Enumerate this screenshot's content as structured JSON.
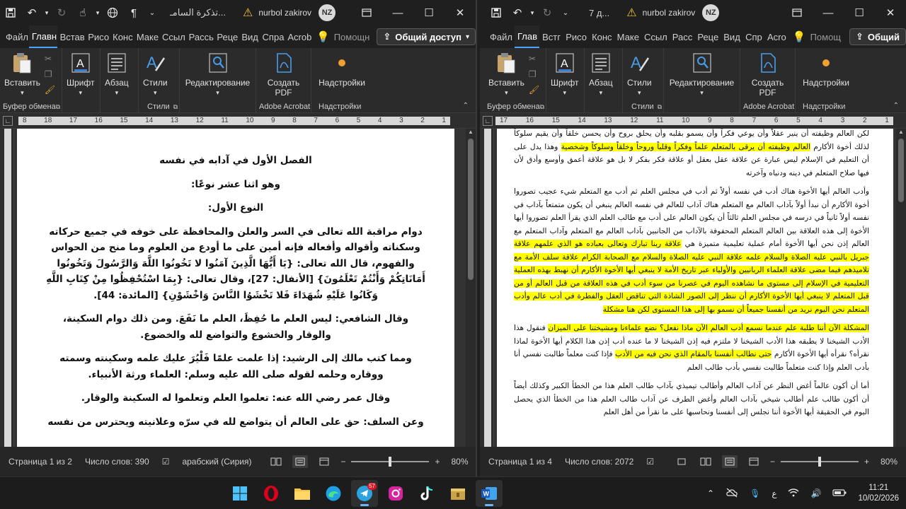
{
  "left_window": {
    "doc_title": "تذكرة السامـ...",
    "user_name": "nurbol zakirov",
    "user_initials": "NZ",
    "tabs": [
      "Файл",
      "Главн",
      "Встав",
      "Рисо",
      "Конс",
      "Маке",
      "Ссыл",
      "Рассь",
      "Реце",
      "Вид",
      "Спра",
      "Acrob"
    ],
    "active_tab_index": 1,
    "help_label": "Помощн",
    "share_label": "Общий доступ",
    "ribbon": {
      "paste_label": "Вставить",
      "font_label": "Шрифт",
      "paragraph_label": "Абзац",
      "styles_label": "Стили",
      "editing_label": "Редактирование",
      "create_pdf_label": "Создать PDF",
      "addins_label": "Надстройки",
      "clipboard_group": "Буфер обмена",
      "styles_group": "Стили",
      "acrobat_group": "Adobe Acrobat",
      "addins_group": "Надстройки"
    },
    "ruler_numbers": [
      "8",
      "18",
      "17",
      "16",
      "15",
      "14",
      "13",
      "12",
      "11",
      "10",
      "9",
      "8",
      "7",
      "6",
      "5",
      "4",
      "3",
      "2",
      "1"
    ],
    "status": {
      "page": "Страница 1 из 2",
      "words": "Число слов: 390",
      "language": "арабский (Сирия)",
      "zoom": "80%",
      "zoom_level": 0.5
    },
    "paragraphs": [
      "الفصل الأول في آدابه في نفسه",
      "وهو اثنا عشر نوعًا:",
      "النوع الأول:",
      "دوام مراقبة الله تعالى في السر والعلن والمحافظة على خوفه في جميع حركاته وسكناته وأقواله وأفعاله فإنه أمين على ما أودع من العلوم وما منح من الحواس والفهوم، قال الله تعالى: {يَا أَيُّهَا الَّذِينَ آمَنُوا لا تَخُونُوا اللَّهَ وَالرَّسُولَ وَتَخُونُوا أَمَانَاتِكُمْ وَأَنْتُمْ تَعْلَمُونَ} [الأنفال: 27]، وقال تعالى: {بِمَا اسْتُحْفِظُوا مِنْ كِتَابِ اللَّهِ وَكَانُوا عَلَيْهِ شُهَدَاءَ فَلا تَخْشَوُا النَّاسَ وَاخْشَوْنِ} [المائدة: 44].",
      "وقال الشافعي: ليس العلم ما حُفِظَ، العلم ما نَفَعَ. ومن ذلك دوام السكينة، والوقار والخشوع والتواضع لله والخضوع.",
      "ومما كتب مالك إلى الرشيد: إذا علمت علمًا فَلْيُرَ عليك علمه وسكينته وسمته ووقاره وحلمه لقوله صلى الله عليه وسلم: العلماء ورثة الأنبياء.",
      "وقال عمر رضي الله عنه: تعلموا العلم وتعلموا له السكينة والوقار.",
      "وعن السلف: حق على العالم أن يتواضع لله في سرّه وعلانيته ويحترس من نفسه"
    ]
  },
  "right_window": {
    "doc_title": "7 д...",
    "user_name": "nurbol zakirov",
    "user_initials": "NZ",
    "tabs": [
      "Файл",
      "Глав",
      "Встг",
      "Рисо",
      "Конс",
      "Маке",
      "Ссыл",
      "Расс",
      "Реце",
      "Вид",
      "Спр",
      "Acro"
    ],
    "active_tab_index": 1,
    "help_label": "Помощ",
    "share_label": "Общий",
    "ribbon": {
      "paste_label": "Вставить",
      "font_label": "Шрифт",
      "paragraph_label": "Абзац",
      "styles_label": "Стили",
      "editing_label": "Редактирование",
      "create_pdf_label": "Создать PDF",
      "addins_label": "Надстройки",
      "clipboard_group": "Буфер обмена",
      "styles_group": "Стили",
      "acrobat_group": "Adobe Acrobat",
      "addins_group": "Надстройки"
    },
    "ruler_numbers": [
      "17",
      "16",
      "15",
      "14",
      "13",
      "12",
      "11",
      "10",
      "9",
      "8",
      "7",
      "6",
      "5",
      "4",
      "3",
      "2",
      "1"
    ],
    "status": {
      "page": "Страница 1 из 4",
      "words": "Число слов: 2072",
      "zoom": "80%",
      "zoom_level": 0.5
    },
    "paragraphs": [
      [
        {
          "t": "لكن العالم وظيفته أن ينير عقلاً وأن يوعي فكراً وأن يسمو بقلبه وأن يحلق بروح وأن يحسن خلقاً وأن يقيم سلوكاً لذلك أخوة الأكارم ",
          "hl": false
        },
        {
          "t": "العالم وظيفته أن يرقى بالمتعلم علماً وفكراً وقلباً وروحاً وخلقاً وسلوكاً وشخصية",
          "hl": true
        },
        {
          "t": " وهذا يدل على أن التعليم في الإسلام ليس عبارة عن علاقة عقل بعقل أو علاقة فكر بفكر لا بل هو علاقة أعمق وأوسع وأدق لأن فيها صلاح المتعلم في دينه ودنياه وآخرته",
          "hl": false
        }
      ],
      [
        {
          "t": "وأدب العالم أيها الأخوة هناك أدب في نفسه أولاً ثم أدب في مجلس العلم ثم أدب مع المتعلم شيء عجيب تصوروا أخوة الأكارم أن نبدأ أولاً بآداب العالم مع المتعلم هناك آداب للعالم في نفسه العالم ينبغي أن يكون متمتعاً بآداب في نفسه أولاً ثانياً في درسه في مجلس العلم ثالثاً أن يكون العالم على أدب مع طالب العلم الذي يقرأ العلم تصوروا أيها الأخوة إلى هذه العلاقة بين العالم المتعلم المحفوفة بالآداب من الجانبين بآداب العالم مع المتعلم وآداب المتعلم مع العالم إذن نحن أيها الأخوة أمام عملية تعليمية متميزة هي ",
          "hl": false
        },
        {
          "t": "علاقة ربنا تبارك وتعالى بعباده هو الذي علمهم علاقة جبريل بالنبي عليه الصلاة والسلام علمه علاقة النبي عليه الصلاة والسلام مع الصحابة الكرام علاقة سلف الأمة مع تلاميذهم فيما مضى علاقة العلماء الربانيين والأولياء عبر تاريخ الأمة لا ينبغي أيها الأخوة الأكارم أن نهبط بهذه العملية التعليمية في الإسلام إلى مستوى ما نشاهده اليوم في عصرنا من سوء أدب في هذه العلاقة من قبل العالم أو من قبل المتعلم لا ينبغي أيها الأخوة الأكارم أن ننظر إلى الصور الشاذة التي تناقض العقل والفطرة في أدب عالم وأدب المتعلم نحن اليوم نريد من أنفسنا جميعاً أن نسمو بها إلى هذا المستوى لكن هنا مشكلة",
          "hl": true
        }
      ],
      [
        {
          "t": "المشكلة الآن أننا طلبة علم عندما نسمع أدب العالم الآن ماذا نفعل؟ نضع علماءنا ومشيختنا على الميزان",
          "hl": true
        },
        {
          "t": " فنقول هذا الأدب الشيخنا لا يطبقه هذا الأدب الشيخنا لا ملتزم فيه إذن الشيخنا لا ما عنده أدب إذن هذا الكلام أيها الأخوة لماذا نقرأه؟ نقرأه أيها الأخوة الأكارم ",
          "hl": false
        },
        {
          "t": "حتى نطالب أنفسنا بالمقام الذي نحن فيه من الأدب",
          "hl": true
        },
        {
          "t": " فإذا كنت معلماً طالبت نفسي أنا بأدب العلم وإذا كنت متعلماً طالبت نفسي بأدب طالب العلم",
          "hl": false
        }
      ],
      [
        {
          "t": "أما أن أكون عالماً أغض النظر عن آداب العالم وأطالب تيميذي بآداب طالب العلم هذا من الخطأ الكبير وكذلك أيضاً أن أكون طالب علم أطالب شيخي بآداب العالم وأغض الطرف عن آداب طالب العلم هذا من الخطأ الذي يحصل اليوم في الحقيقة أيها الأخوة أننا نجلس إلى أنفسنا ونحاسبها على ما نقرأ من أهل العلم",
          "hl": false
        }
      ]
    ]
  },
  "taskbar": {
    "telegram_badge": "57",
    "keyboard_lang": "ع",
    "time": "11:21",
    "date": "10/02/2026"
  }
}
